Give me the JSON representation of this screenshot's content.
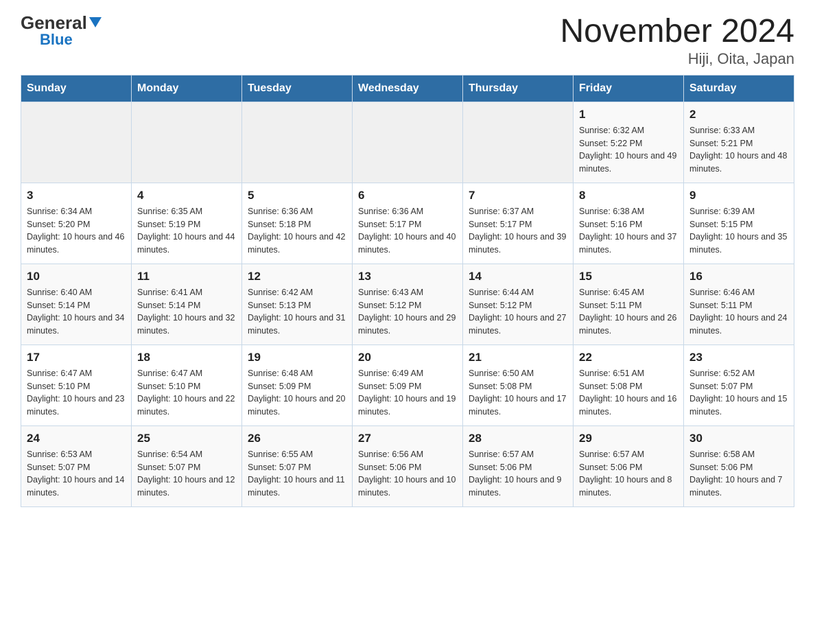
{
  "logo": {
    "general_text": "General",
    "blue_text": "Blue"
  },
  "title": "November 2024",
  "subtitle": "Hiji, Oita, Japan",
  "days_of_week": [
    "Sunday",
    "Monday",
    "Tuesday",
    "Wednesday",
    "Thursday",
    "Friday",
    "Saturday"
  ],
  "weeks": [
    [
      {
        "day": "",
        "info": ""
      },
      {
        "day": "",
        "info": ""
      },
      {
        "day": "",
        "info": ""
      },
      {
        "day": "",
        "info": ""
      },
      {
        "day": "",
        "info": ""
      },
      {
        "day": "1",
        "info": "Sunrise: 6:32 AM\nSunset: 5:22 PM\nDaylight: 10 hours and 49 minutes."
      },
      {
        "day": "2",
        "info": "Sunrise: 6:33 AM\nSunset: 5:21 PM\nDaylight: 10 hours and 48 minutes."
      }
    ],
    [
      {
        "day": "3",
        "info": "Sunrise: 6:34 AM\nSunset: 5:20 PM\nDaylight: 10 hours and 46 minutes."
      },
      {
        "day": "4",
        "info": "Sunrise: 6:35 AM\nSunset: 5:19 PM\nDaylight: 10 hours and 44 minutes."
      },
      {
        "day": "5",
        "info": "Sunrise: 6:36 AM\nSunset: 5:18 PM\nDaylight: 10 hours and 42 minutes."
      },
      {
        "day": "6",
        "info": "Sunrise: 6:36 AM\nSunset: 5:17 PM\nDaylight: 10 hours and 40 minutes."
      },
      {
        "day": "7",
        "info": "Sunrise: 6:37 AM\nSunset: 5:17 PM\nDaylight: 10 hours and 39 minutes."
      },
      {
        "day": "8",
        "info": "Sunrise: 6:38 AM\nSunset: 5:16 PM\nDaylight: 10 hours and 37 minutes."
      },
      {
        "day": "9",
        "info": "Sunrise: 6:39 AM\nSunset: 5:15 PM\nDaylight: 10 hours and 35 minutes."
      }
    ],
    [
      {
        "day": "10",
        "info": "Sunrise: 6:40 AM\nSunset: 5:14 PM\nDaylight: 10 hours and 34 minutes."
      },
      {
        "day": "11",
        "info": "Sunrise: 6:41 AM\nSunset: 5:14 PM\nDaylight: 10 hours and 32 minutes."
      },
      {
        "day": "12",
        "info": "Sunrise: 6:42 AM\nSunset: 5:13 PM\nDaylight: 10 hours and 31 minutes."
      },
      {
        "day": "13",
        "info": "Sunrise: 6:43 AM\nSunset: 5:12 PM\nDaylight: 10 hours and 29 minutes."
      },
      {
        "day": "14",
        "info": "Sunrise: 6:44 AM\nSunset: 5:12 PM\nDaylight: 10 hours and 27 minutes."
      },
      {
        "day": "15",
        "info": "Sunrise: 6:45 AM\nSunset: 5:11 PM\nDaylight: 10 hours and 26 minutes."
      },
      {
        "day": "16",
        "info": "Sunrise: 6:46 AM\nSunset: 5:11 PM\nDaylight: 10 hours and 24 minutes."
      }
    ],
    [
      {
        "day": "17",
        "info": "Sunrise: 6:47 AM\nSunset: 5:10 PM\nDaylight: 10 hours and 23 minutes."
      },
      {
        "day": "18",
        "info": "Sunrise: 6:47 AM\nSunset: 5:10 PM\nDaylight: 10 hours and 22 minutes."
      },
      {
        "day": "19",
        "info": "Sunrise: 6:48 AM\nSunset: 5:09 PM\nDaylight: 10 hours and 20 minutes."
      },
      {
        "day": "20",
        "info": "Sunrise: 6:49 AM\nSunset: 5:09 PM\nDaylight: 10 hours and 19 minutes."
      },
      {
        "day": "21",
        "info": "Sunrise: 6:50 AM\nSunset: 5:08 PM\nDaylight: 10 hours and 17 minutes."
      },
      {
        "day": "22",
        "info": "Sunrise: 6:51 AM\nSunset: 5:08 PM\nDaylight: 10 hours and 16 minutes."
      },
      {
        "day": "23",
        "info": "Sunrise: 6:52 AM\nSunset: 5:07 PM\nDaylight: 10 hours and 15 minutes."
      }
    ],
    [
      {
        "day": "24",
        "info": "Sunrise: 6:53 AM\nSunset: 5:07 PM\nDaylight: 10 hours and 14 minutes."
      },
      {
        "day": "25",
        "info": "Sunrise: 6:54 AM\nSunset: 5:07 PM\nDaylight: 10 hours and 12 minutes."
      },
      {
        "day": "26",
        "info": "Sunrise: 6:55 AM\nSunset: 5:07 PM\nDaylight: 10 hours and 11 minutes."
      },
      {
        "day": "27",
        "info": "Sunrise: 6:56 AM\nSunset: 5:06 PM\nDaylight: 10 hours and 10 minutes."
      },
      {
        "day": "28",
        "info": "Sunrise: 6:57 AM\nSunset: 5:06 PM\nDaylight: 10 hours and 9 minutes."
      },
      {
        "day": "29",
        "info": "Sunrise: 6:57 AM\nSunset: 5:06 PM\nDaylight: 10 hours and 8 minutes."
      },
      {
        "day": "30",
        "info": "Sunrise: 6:58 AM\nSunset: 5:06 PM\nDaylight: 10 hours and 7 minutes."
      }
    ]
  ]
}
